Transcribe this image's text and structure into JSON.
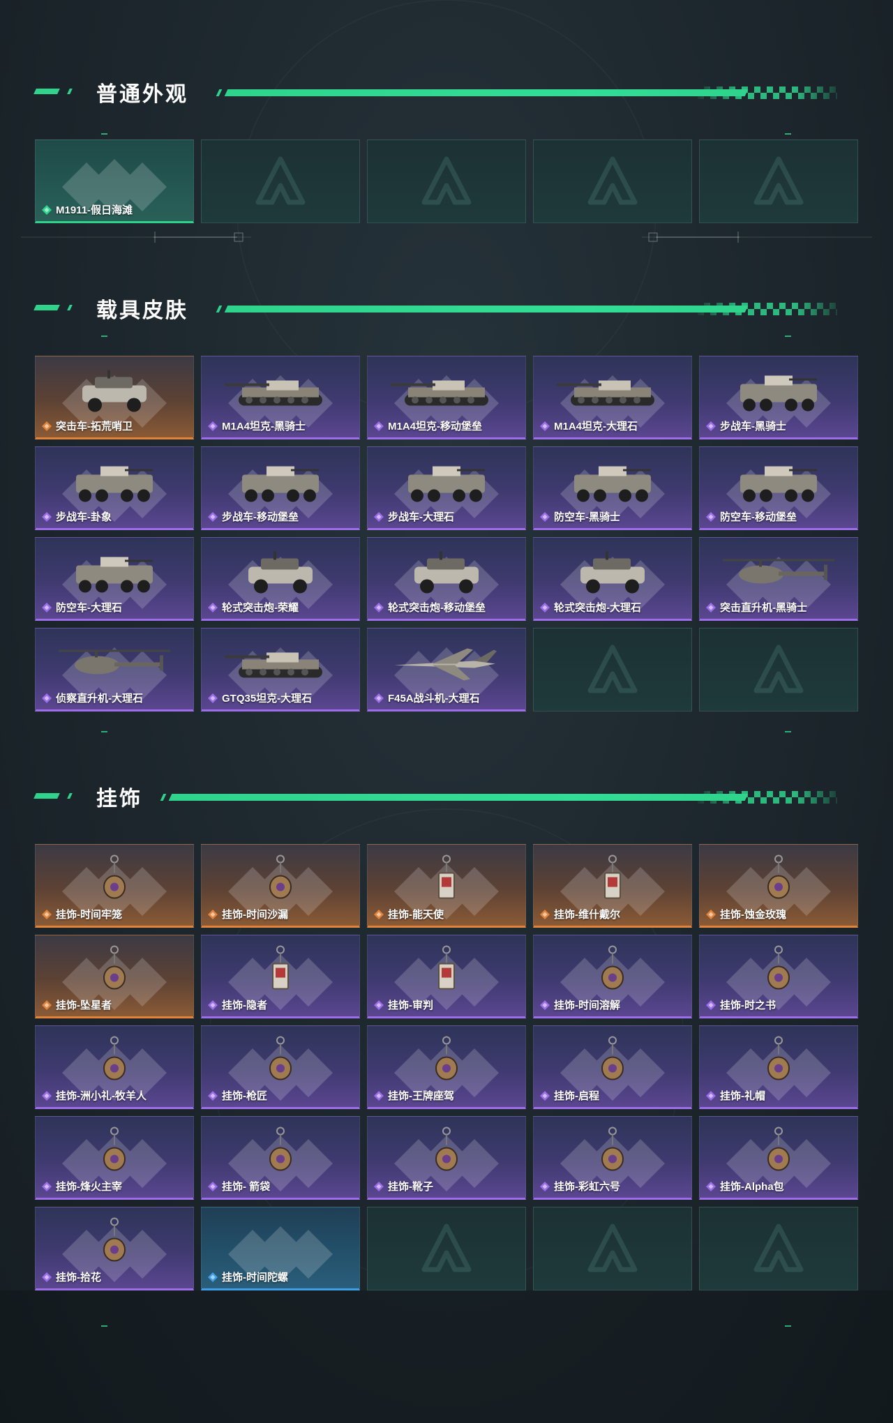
{
  "sections": [
    {
      "title": "普通外观",
      "items": [
        {
          "label": "M1911-假日海滩",
          "rarity": "teal",
          "art": "none"
        },
        {
          "label": "",
          "rarity": "empty"
        },
        {
          "label": "",
          "rarity": "empty"
        },
        {
          "label": "",
          "rarity": "empty"
        },
        {
          "label": "",
          "rarity": "empty"
        }
      ]
    },
    {
      "title": "载具皮肤",
      "items": [
        {
          "label": "突击车-拓荒哨卫",
          "rarity": "orange",
          "art": "armored-car"
        },
        {
          "label": "M1A4坦克-黑骑士",
          "rarity": "purple",
          "art": "tank"
        },
        {
          "label": "M1A4坦克-移动堡垒",
          "rarity": "purple",
          "art": "tank"
        },
        {
          "label": "M1A4坦克-大理石",
          "rarity": "purple",
          "art": "tank"
        },
        {
          "label": "步战车-黑骑士",
          "rarity": "purple",
          "art": "ifv"
        },
        {
          "label": "步战车-卦象",
          "rarity": "purple",
          "art": "ifv"
        },
        {
          "label": "步战车-移动堡垒",
          "rarity": "purple",
          "art": "ifv"
        },
        {
          "label": "步战车-大理石",
          "rarity": "purple",
          "art": "ifv"
        },
        {
          "label": "防空车-黑骑士",
          "rarity": "purple",
          "art": "ifv"
        },
        {
          "label": "防空车-移动堡垒",
          "rarity": "purple",
          "art": "ifv"
        },
        {
          "label": "防空车-大理石",
          "rarity": "purple",
          "art": "ifv"
        },
        {
          "label": "轮式突击炮-荣耀",
          "rarity": "purple",
          "art": "buggy"
        },
        {
          "label": "轮式突击炮-移动堡垒",
          "rarity": "purple",
          "art": "armored-car"
        },
        {
          "label": "轮式突击炮-大理石",
          "rarity": "purple",
          "art": "armored-car"
        },
        {
          "label": "突击直升机-黑骑士",
          "rarity": "purple",
          "art": "helicopter"
        },
        {
          "label": "侦察直升机-大理石",
          "rarity": "purple",
          "art": "helicopter"
        },
        {
          "label": "GTQ35坦克-大理石",
          "rarity": "purple",
          "art": "tank"
        },
        {
          "label": "F45A战斗机-大理石",
          "rarity": "purple",
          "art": "jet"
        },
        {
          "label": "",
          "rarity": "empty"
        },
        {
          "label": "",
          "rarity": "empty"
        }
      ]
    },
    {
      "title": "挂饰",
      "items": [
        {
          "label": "挂饰-时间牢笼",
          "rarity": "orange",
          "art": "charm"
        },
        {
          "label": "挂饰-时间沙漏",
          "rarity": "orange",
          "art": "charm"
        },
        {
          "label": "挂饰-能天使",
          "rarity": "orange",
          "art": "charm-card"
        },
        {
          "label": "挂饰-维什戴尔",
          "rarity": "orange",
          "art": "charm-card"
        },
        {
          "label": "挂饰-蚀金玫瑰",
          "rarity": "orange",
          "art": "charm"
        },
        {
          "label": "挂饰-坠星者",
          "rarity": "orange",
          "art": "charm"
        },
        {
          "label": "挂饰-隐者",
          "rarity": "purple",
          "art": "charm-card"
        },
        {
          "label": "挂饰-审判",
          "rarity": "purple",
          "art": "charm-card"
        },
        {
          "label": "挂饰-时间溶解",
          "rarity": "purple",
          "art": "charm"
        },
        {
          "label": "挂饰-时之书",
          "rarity": "purple",
          "art": "charm"
        },
        {
          "label": "挂饰-洲小礼-牧羊人",
          "rarity": "purple",
          "art": "charm"
        },
        {
          "label": "挂饰-枪匠",
          "rarity": "purple",
          "art": "charm"
        },
        {
          "label": "挂饰-王牌座驾",
          "rarity": "purple",
          "art": "charm"
        },
        {
          "label": "挂饰-启程",
          "rarity": "purple",
          "art": "charm"
        },
        {
          "label": "挂饰-礼帽",
          "rarity": "purple",
          "art": "charm"
        },
        {
          "label": "挂饰-烽火主宰",
          "rarity": "purple",
          "art": "charm"
        },
        {
          "label": "挂饰- 箭袋",
          "rarity": "purple",
          "art": "charm"
        },
        {
          "label": "挂饰-靴子",
          "rarity": "purple",
          "art": "charm"
        },
        {
          "label": "挂饰-彩虹六号",
          "rarity": "purple",
          "art": "charm"
        },
        {
          "label": "挂饰-Alpha包",
          "rarity": "purple",
          "art": "charm"
        },
        {
          "label": "挂饰-拾花",
          "rarity": "purple",
          "art": "charm"
        },
        {
          "label": "挂饰-时间陀螺",
          "rarity": "blue",
          "art": "none"
        },
        {
          "label": "",
          "rarity": "empty"
        },
        {
          "label": "",
          "rarity": "empty"
        },
        {
          "label": "",
          "rarity": "empty"
        }
      ]
    }
  ],
  "colors": {
    "accent": "#2fd38c",
    "orange": "#e0833b",
    "purple": "#9c6ee8",
    "blue": "#3f9ee8",
    "teal": "#2fd38c"
  }
}
